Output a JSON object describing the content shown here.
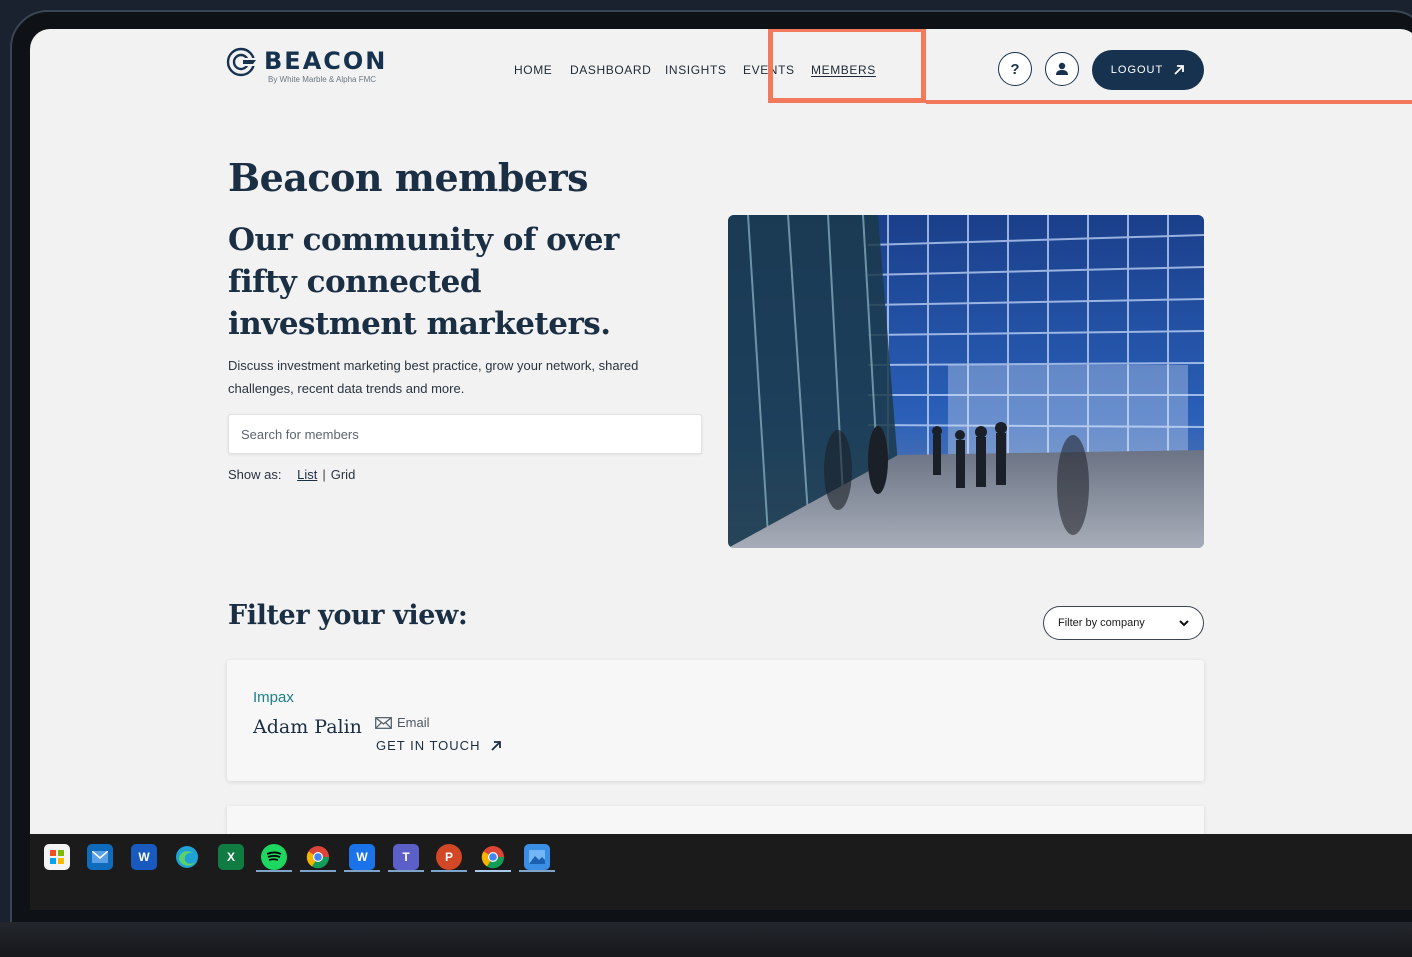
{
  "brand": {
    "name": "BEACON",
    "tagline": "By White Marble & Alpha FMC"
  },
  "nav": {
    "items": [
      {
        "label": "HOME",
        "key": "home"
      },
      {
        "label": "DASHBOARD",
        "key": "dashboard"
      },
      {
        "label": "INSIGHTS",
        "key": "insights"
      },
      {
        "label": "EVENTS",
        "key": "events"
      },
      {
        "label": "MEMBERS",
        "key": "members",
        "active": true
      }
    ],
    "help_label": "?",
    "logout_label": "LOGOUT"
  },
  "hero": {
    "title": "Beacon members",
    "subtitle": "Our community of over fifty connected investment marketers.",
    "description": "Discuss investment marketing best practice, grow your network, shared challenges, recent data trends and more.",
    "search_placeholder": "Search for members",
    "show_as_label": "Show as:",
    "view_list": "List",
    "view_grid": "Grid",
    "view_selected": "List"
  },
  "filter": {
    "title": "Filter your view:",
    "select_value": "Filter by company"
  },
  "members": [
    {
      "company": "Impax",
      "name": "Adam Palin",
      "email_label": "Email",
      "contact_label": "GET IN TOUCH"
    }
  ],
  "taskbar": {
    "icons": [
      "start-icon",
      "mail-icon",
      "word-icon",
      "edge-icon",
      "excel-icon",
      "spotify-icon",
      "chrome-icon",
      "webex-icon",
      "teams-icon",
      "powerpoint-icon",
      "chrome-profile-icon",
      "photos-icon"
    ]
  },
  "colors": {
    "brand_navy": "#17324f",
    "accent_teal": "#1e7e86",
    "highlight": "#f2795c",
    "page_bg": "#f2f2f2"
  }
}
